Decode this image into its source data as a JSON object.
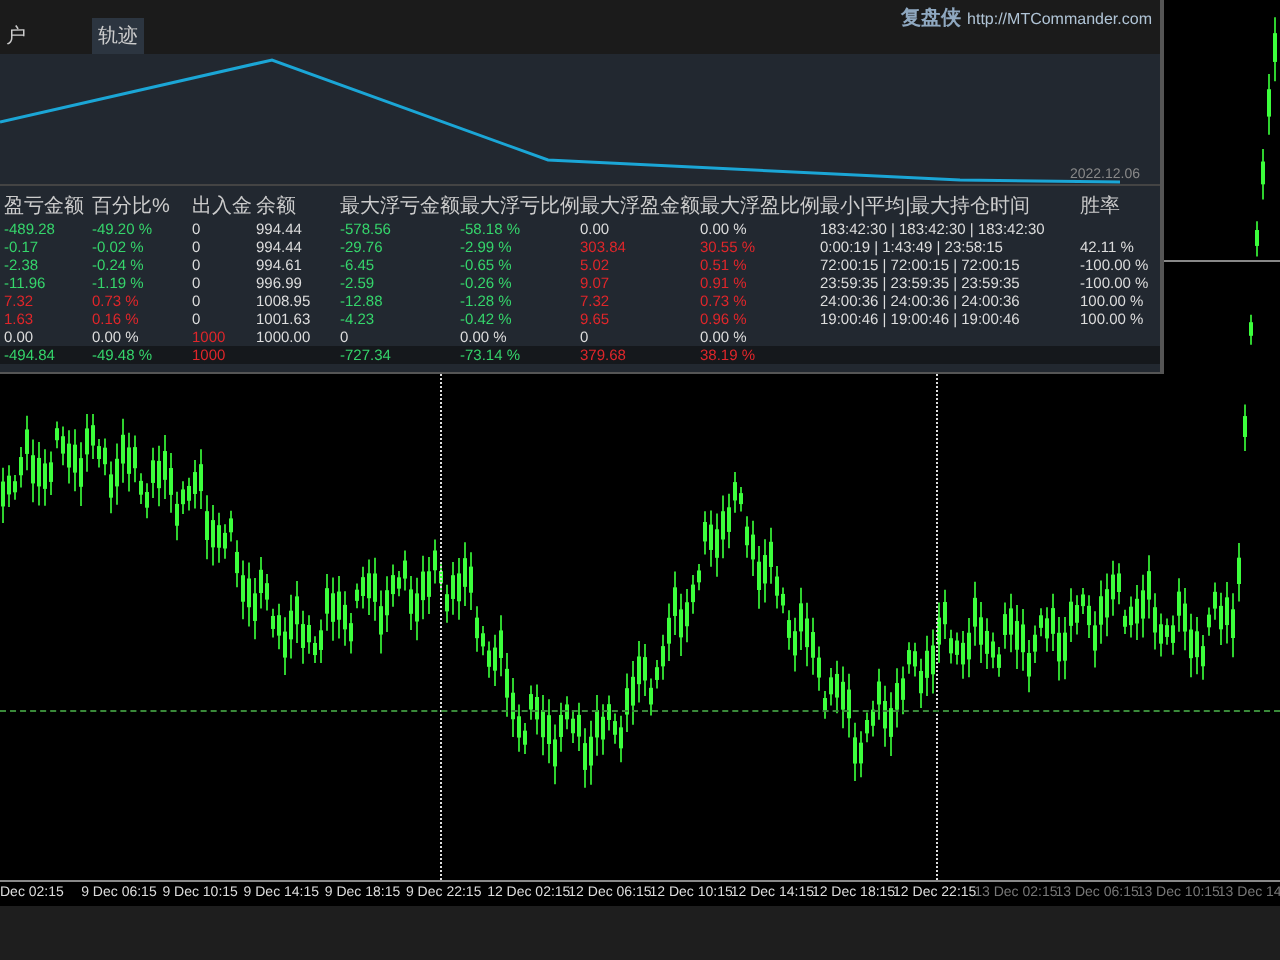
{
  "panel": {
    "tabs": [
      {
        "label": "户",
        "selected": false
      },
      {
        "label": "轨迹",
        "selected": true
      }
    ],
    "brand": "复盘侠",
    "url": "http://MTCommander.com",
    "equity_date": "2022.12.06",
    "table": {
      "columns": [
        "盈亏金额",
        "百分比%",
        "出入金",
        "余额",
        "最大浮亏金额",
        "最大浮亏比例",
        "最大浮盈金额",
        "最大浮盈比例",
        "最小|平均|最大持仓时间",
        "胜率"
      ],
      "rows": [
        {
          "total": false,
          "cells": [
            {
              "text": "-489.28",
              "color": "#35d56b"
            },
            {
              "text": "-49.20 %",
              "color": "#35d56b"
            },
            {
              "text": "0",
              "color": "#dddddd"
            },
            {
              "text": "994.44",
              "color": "#dddddd"
            },
            {
              "text": "-578.56",
              "color": "#35d56b"
            },
            {
              "text": "-58.18 %",
              "color": "#35d56b"
            },
            {
              "text": "0.00",
              "color": "#dddddd"
            },
            {
              "text": "0.00 %",
              "color": "#dddddd"
            },
            {
              "text": "183:42:30 | 183:42:30 | 183:42:30",
              "color": "#dddddd"
            },
            null
          ]
        },
        {
          "total": false,
          "cells": [
            {
              "text": "-0.17",
              "color": "#35d56b"
            },
            {
              "text": "-0.02 %",
              "color": "#35d56b"
            },
            {
              "text": "0",
              "color": "#dddddd"
            },
            {
              "text": "994.44",
              "color": "#dddddd"
            },
            {
              "text": "-29.76",
              "color": "#35d56b"
            },
            {
              "text": "-2.99 %",
              "color": "#35d56b"
            },
            {
              "text": "303.84",
              "color": "#e0262a"
            },
            {
              "text": "30.55 %",
              "color": "#e0262a"
            },
            {
              "text": "0:00:19 | 1:43:49 | 23:58:15",
              "color": "#dddddd"
            },
            {
              "text": "42.11 %",
              "color": "#dddddd"
            }
          ]
        },
        {
          "total": false,
          "cells": [
            {
              "text": "-2.38",
              "color": "#35d56b"
            },
            {
              "text": "-0.24 %",
              "color": "#35d56b"
            },
            {
              "text": "0",
              "color": "#dddddd"
            },
            {
              "text": "994.61",
              "color": "#dddddd"
            },
            {
              "text": "-6.45",
              "color": "#35d56b"
            },
            {
              "text": "-0.65 %",
              "color": "#35d56b"
            },
            {
              "text": "5.02",
              "color": "#e0262a"
            },
            {
              "text": "0.51 %",
              "color": "#e0262a"
            },
            {
              "text": "72:00:15 | 72:00:15 | 72:00:15",
              "color": "#dddddd"
            },
            {
              "text": "-100.00 %",
              "color": "#dddddd"
            }
          ]
        },
        {
          "total": false,
          "cells": [
            {
              "text": "-11.96",
              "color": "#35d56b"
            },
            {
              "text": "-1.19 %",
              "color": "#35d56b"
            },
            {
              "text": "0",
              "color": "#dddddd"
            },
            {
              "text": "996.99",
              "color": "#dddddd"
            },
            {
              "text": "-2.59",
              "color": "#35d56b"
            },
            {
              "text": "-0.26 %",
              "color": "#35d56b"
            },
            {
              "text": "9.07",
              "color": "#e0262a"
            },
            {
              "text": "0.91 %",
              "color": "#e0262a"
            },
            {
              "text": "23:59:35 | 23:59:35 | 23:59:35",
              "color": "#dddddd"
            },
            {
              "text": "-100.00 %",
              "color": "#dddddd"
            }
          ]
        },
        {
          "total": false,
          "cells": [
            {
              "text": "7.32",
              "color": "#e0262a"
            },
            {
              "text": "0.73 %",
              "color": "#e0262a"
            },
            {
              "text": "0",
              "color": "#dddddd"
            },
            {
              "text": "1008.95",
              "color": "#dddddd"
            },
            {
              "text": "-12.88",
              "color": "#35d56b"
            },
            {
              "text": "-1.28 %",
              "color": "#35d56b"
            },
            {
              "text": "7.32",
              "color": "#e0262a"
            },
            {
              "text": "0.73 %",
              "color": "#e0262a"
            },
            {
              "text": "24:00:36 | 24:00:36 | 24:00:36",
              "color": "#dddddd"
            },
            {
              "text": "100.00 %",
              "color": "#dddddd"
            }
          ]
        },
        {
          "total": false,
          "cells": [
            {
              "text": "1.63",
              "color": "#e0262a"
            },
            {
              "text": "0.16 %",
              "color": "#e0262a"
            },
            {
              "text": "0",
              "color": "#dddddd"
            },
            {
              "text": "1001.63",
              "color": "#dddddd"
            },
            {
              "text": "-4.23",
              "color": "#35d56b"
            },
            {
              "text": "-0.42 %",
              "color": "#35d56b"
            },
            {
              "text": "9.65",
              "color": "#e0262a"
            },
            {
              "text": "0.96 %",
              "color": "#e0262a"
            },
            {
              "text": "19:00:46 | 19:00:46 | 19:00:46",
              "color": "#dddddd"
            },
            {
              "text": "100.00 %",
              "color": "#dddddd"
            }
          ]
        },
        {
          "total": false,
          "cells": [
            {
              "text": "0.00",
              "color": "#dddddd"
            },
            {
              "text": "0.00 %",
              "color": "#dddddd"
            },
            {
              "text": "1000",
              "color": "#e0262a"
            },
            {
              "text": "1000.00",
              "color": "#dddddd"
            },
            {
              "text": "0",
              "color": "#dddddd"
            },
            {
              "text": "0.00 %",
              "color": "#dddddd"
            },
            {
              "text": "0",
              "color": "#dddddd"
            },
            {
              "text": "0.00 %",
              "color": "#dddddd"
            },
            null,
            null
          ]
        },
        {
          "total": true,
          "cells": [
            {
              "text": "-494.84",
              "color": "#35d56b"
            },
            {
              "text": "-49.48 %",
              "color": "#35d56b"
            },
            {
              "text": "1000",
              "color": "#e0262a"
            },
            null,
            {
              "text": "-727.34",
              "color": "#35d56b"
            },
            {
              "text": "-73.14 %",
              "color": "#35d56b"
            },
            {
              "text": "379.68",
              "color": "#e0262a"
            },
            {
              "text": "38.19 %",
              "color": "#e0262a"
            },
            null,
            null
          ]
        }
      ]
    }
  },
  "time_axis": [
    "Dec 02:15",
    "9 Dec 06:15",
    "9 Dec 10:15",
    "9 Dec 14:15",
    "9 Dec 18:15",
    "9 Dec 22:15",
    "12 Dec 02:15",
    "12 Dec 06:15",
    "12 Dec 10:15",
    "12 Dec 14:15",
    "12 Dec 18:15",
    "12 Dec 22:15",
    "13 Dec 02:15",
    "13 Dec 06:15",
    "13 Dec 10:15",
    "13 Dec 14"
  ]
}
